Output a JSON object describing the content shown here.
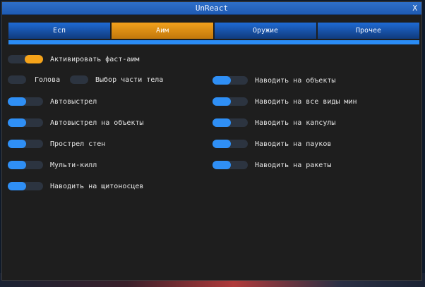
{
  "window": {
    "title": "UnReact",
    "close_label": "X"
  },
  "tabs": [
    {
      "label": "Есп"
    },
    {
      "label": "Аим"
    },
    {
      "label": "Оружие"
    },
    {
      "label": "Прочее"
    }
  ],
  "active_tab": "Аим",
  "colors": {
    "accent": "#2f8ff5",
    "active_tab": "#f2a11c",
    "panel": "#1e1e1e",
    "toggle_off": "#2c3440"
  },
  "fast_aim": {
    "label": "Активировать фаст-аим",
    "enabled": true
  },
  "head": {
    "label": "Голова",
    "enabled": false
  },
  "body_part": {
    "label": "Выбор части тела",
    "enabled": false
  },
  "left_options": [
    {
      "label": "Автовыстрел",
      "enabled": true
    },
    {
      "label": "Автовыстрел на объекты",
      "enabled": true
    },
    {
      "label": "Прострел стен",
      "enabled": true
    },
    {
      "label": "Мульти-килл",
      "enabled": true
    },
    {
      "label": "Наводить на щитоносцев",
      "enabled": true
    }
  ],
  "right_options": [
    {
      "label": "Наводить на объекты",
      "enabled": true
    },
    {
      "label": "Наводить на все виды мин",
      "enabled": true
    },
    {
      "label": "Наводить на капсулы",
      "enabled": true
    },
    {
      "label": "Наводить на пауков",
      "enabled": true
    },
    {
      "label": "Наводить на ракеты",
      "enabled": true
    }
  ]
}
